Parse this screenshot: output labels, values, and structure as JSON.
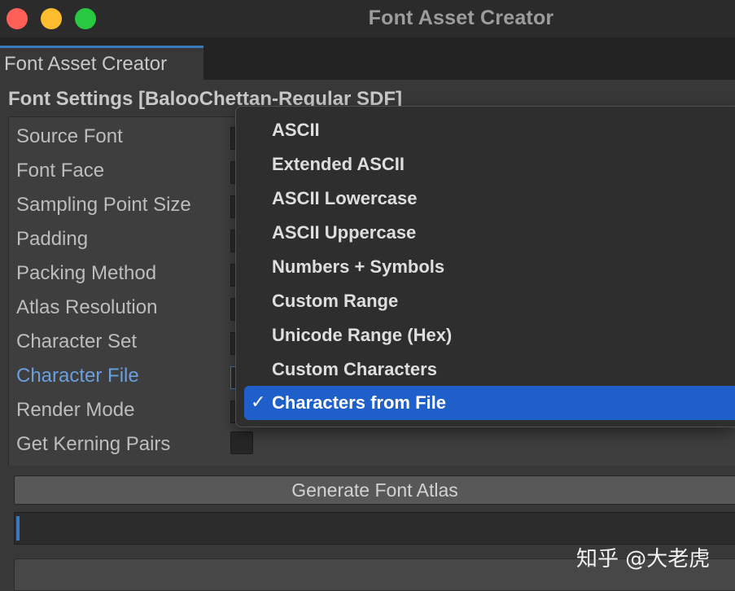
{
  "window": {
    "title": "Font Asset Creator"
  },
  "tab": {
    "label": "Font Asset Creator"
  },
  "section": {
    "title": "Font Settings [BalooChettan-Regular SDF]"
  },
  "settings": [
    "Source Font",
    "Font Face",
    "Sampling Point Size",
    "Padding",
    "Packing Method",
    "Atlas Resolution",
    "Character Set",
    "Character File",
    "Render Mode",
    "Get Kerning Pairs"
  ],
  "dropdown": {
    "options": [
      "ASCII",
      "Extended ASCII",
      "ASCII Lowercase",
      "ASCII Uppercase",
      "Numbers + Symbols",
      "Custom Range",
      "Unicode Range (Hex)",
      "Custom Characters",
      "Characters from File"
    ],
    "selected": "Characters from File",
    "check_glyph": "✓"
  },
  "buttons": {
    "generate": "Generate Font Atlas"
  },
  "watermark": {
    "text": "知乎 @大老虎"
  },
  "colors": {
    "accent": "#3a79bb",
    "selection": "#1f5fc9",
    "highlight_text": "#6a9fe0"
  }
}
